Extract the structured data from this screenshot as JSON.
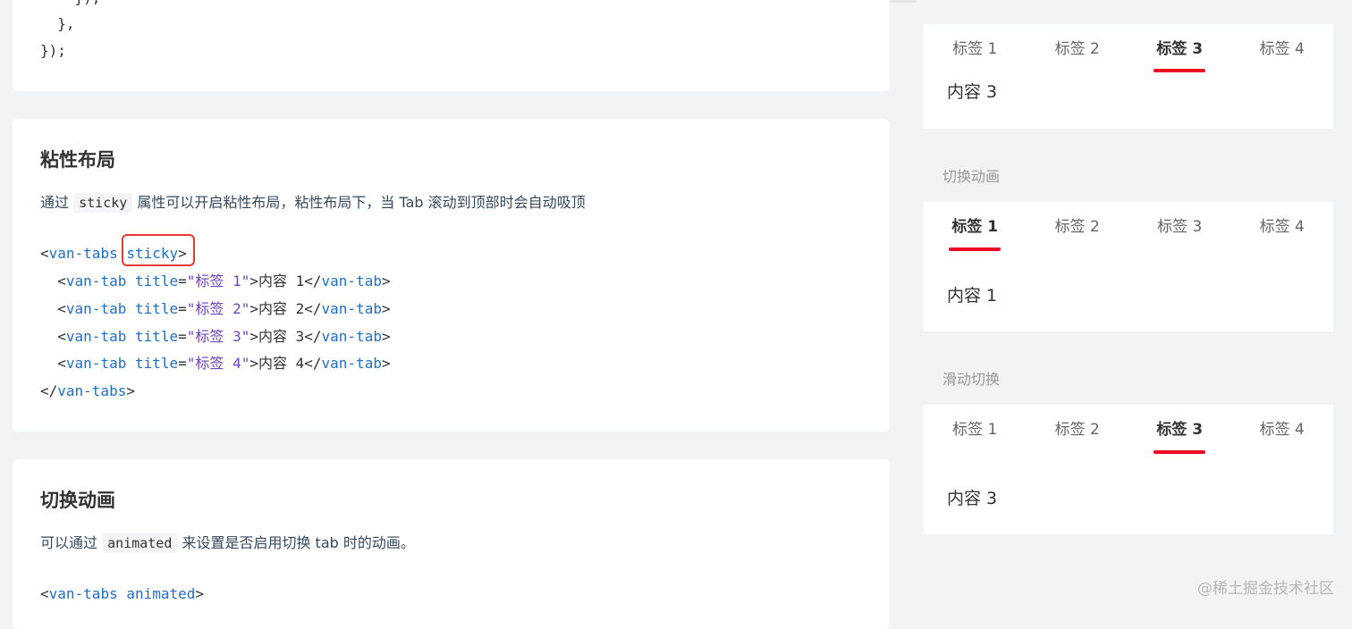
{
  "top_snippet": {
    "lines": [
      "    }),",
      "  },",
      "});"
    ]
  },
  "sticky_section": {
    "title": "粘性布局",
    "desc_prefix": "通过",
    "desc_code": "sticky",
    "desc_suffix": "属性可以开启粘性布局，粘性布局下，当 Tab 滚动到顶部时会自动吸顶",
    "code": {
      "open_tag": "van-tabs",
      "open_attr": "sticky",
      "tab_tag": "van-tab",
      "tab_attr": "title",
      "tabs": [
        {
          "title": "\"标签 1\"",
          "content": "内容 1"
        },
        {
          "title": "\"标签 2\"",
          "content": "内容 2"
        },
        {
          "title": "\"标签 3\"",
          "content": "内容 3"
        },
        {
          "title": "\"标签 4\"",
          "content": "内容 4"
        }
      ],
      "close_tag": "van-tabs"
    }
  },
  "animated_section": {
    "title": "切换动画",
    "desc_prefix": "可以通过",
    "desc_code": "animated",
    "desc_suffix": "来设置是否启用切换 tab 时的动画。",
    "code_tag": "van-tabs",
    "code_attr": "animated"
  },
  "demo": {
    "tab_labels": [
      "标签 1",
      "标签 2",
      "标签 3",
      "标签 4"
    ],
    "block1": {
      "active_index": 2,
      "content": "内容 3"
    },
    "block2": {
      "title": "切换动画",
      "active_index": 0,
      "content": "内容 1"
    },
    "block3": {
      "title": "滑动切换",
      "active_index": 2,
      "content": "内容 3"
    }
  },
  "watermark": "@稀土掘金技术社区",
  "colors": {
    "accent": "#ee0a24",
    "highlight": "#e53935",
    "code_tag": "#1f6fc5",
    "code_string": "#6f42c1"
  }
}
